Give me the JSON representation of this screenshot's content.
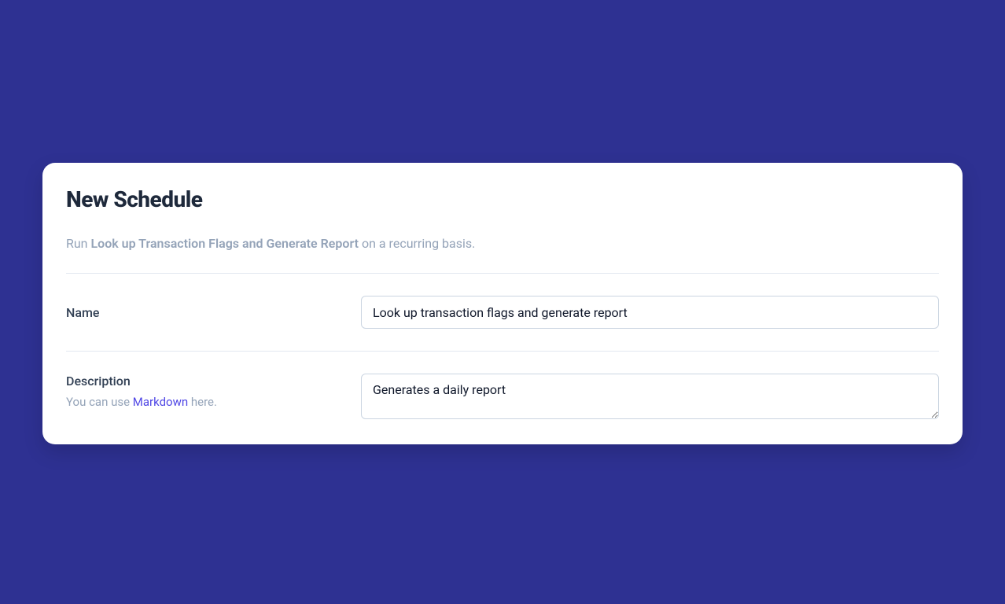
{
  "modal": {
    "title": "New Schedule",
    "subtitle_prefix": "Run ",
    "subtitle_bold": "Look up Transaction Flags and Generate Report",
    "subtitle_suffix": " on a recurring basis."
  },
  "form": {
    "name": {
      "label": "Name",
      "value": "Look up transaction flags and generate report"
    },
    "description": {
      "label": "Description",
      "hint_prefix": "You can use ",
      "hint_link": "Markdown",
      "hint_suffix": " here.",
      "value": "Generates a daily report"
    }
  }
}
